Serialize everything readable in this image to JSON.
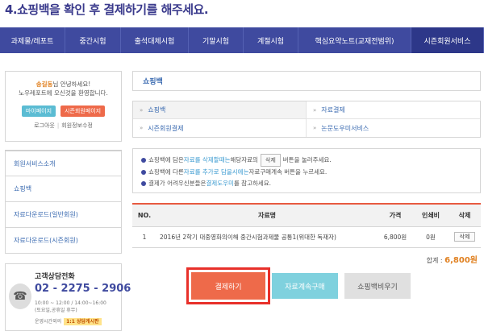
{
  "heading": "4.쇼핑백을 확인 후 결제하기를 해주세요.",
  "nav": {
    "items": [
      {
        "label": "과제물/레포트",
        "width": 81
      },
      {
        "label": "중간시험",
        "width": 69
      },
      {
        "label": "출석대체시험",
        "width": 84
      },
      {
        "label": "기말시험",
        "width": 68
      },
      {
        "label": "계절시험",
        "width": 68
      },
      {
        "label": "핵심요약노트(교재전범위)",
        "width": 140
      },
      {
        "label": "시즌회원서비스",
        "width": 90
      }
    ]
  },
  "user": {
    "name": "송길동",
    "greeting_suffix": "님 안녕하세요!",
    "welcome": "노우레포트에 오신것을 환영합니다.",
    "mypage": "마이페이지",
    "season_page": "시즌회원페이지",
    "logout": "로그아웃",
    "edit_profile": "회원정보수정"
  },
  "side_menu": [
    "회원서비스소개",
    "쇼핑백",
    "자료다운로드(일반회원)",
    "자료다운로드(시즌회원)"
  ],
  "contact": {
    "title": "고객상담전화",
    "number": "02 - 2275 - 2906",
    "hours1": "10:00 ~ 12:00 / 14:00~16:00",
    "hours2": "(토요일,공휴일 휴무)",
    "consult": "운영시간외의",
    "consult_tag": "1:1 상담게시판"
  },
  "page_title": "쇼핑백",
  "tabs": [
    "쇼핑백",
    "자료결제",
    "시즌회원결제",
    "논문도우미서비스"
  ],
  "notice": {
    "l1a": "쇼핑백에 담은 ",
    "l1b": "자료를 삭제할때는",
    "l1c": " 해당자료의 ",
    "l1btn": "삭제",
    "l1d": " 버튼을 눌러주세요.",
    "l2a": "쇼핑백에 다른 ",
    "l2b": "자료를 추가로 담을시에는",
    "l2c": " 자료구매계속 버튼을 누르세요.",
    "l3a": "결제가 어려우신분들은 ",
    "l3b": "결제도우미",
    "l3c": "를 참고하세요."
  },
  "table": {
    "headers": [
      "NO.",
      "자료명",
      "가격",
      "인쇄비",
      "삭제"
    ],
    "rows": [
      {
        "no": "1",
        "title": "2016년 2학기 대중영화의이해 중간시험과제물 공통1(위대한 독재자)",
        "price": "6,800원",
        "print": "0원",
        "delete": "삭제"
      }
    ]
  },
  "total_label": "합계 :",
  "total_amount": "6,800원",
  "buttons": {
    "pay": "결제하기",
    "continue": "자료계속구매",
    "empty": "쇼핑백비우기"
  }
}
